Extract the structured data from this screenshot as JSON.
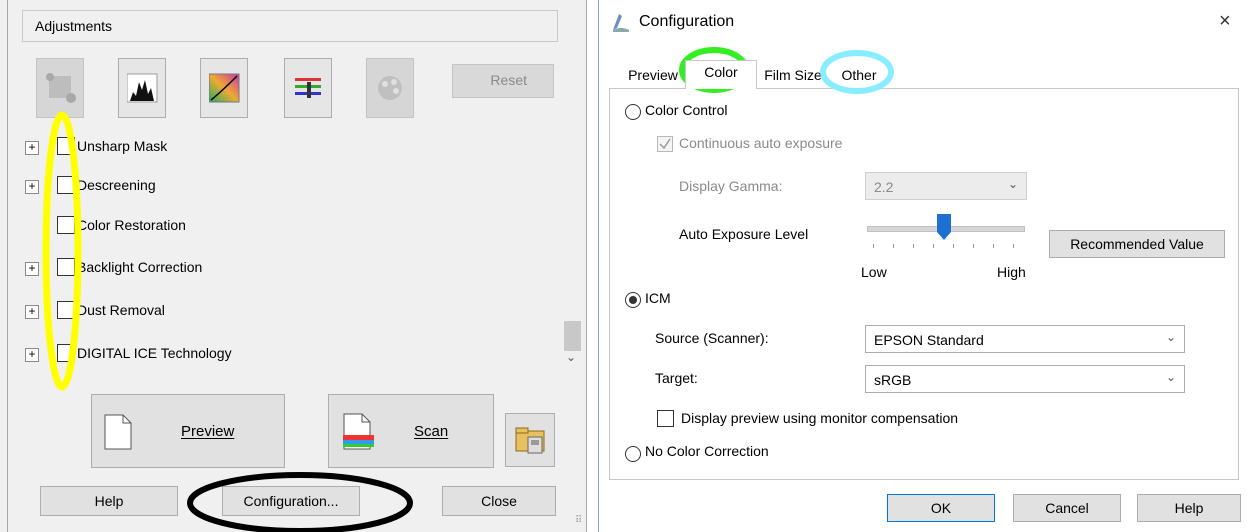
{
  "left_panel": {
    "adjustments_title": "Adjustments",
    "reset_label": "Reset",
    "adjustments": [
      {
        "label": "Unsharp Mask",
        "expandable": true
      },
      {
        "label": "Descreening",
        "expandable": true
      },
      {
        "label": "Color Restoration",
        "expandable": false
      },
      {
        "label": "Backlight Correction",
        "expandable": true
      },
      {
        "label": "Dust Removal",
        "expandable": true
      },
      {
        "label": "DIGITAL ICE Technology",
        "expandable": true
      }
    ],
    "expander_symbol": "+",
    "preview_label": "Preview",
    "scan_label": "Scan",
    "help_label": "Help",
    "configuration_label": "Configuration...",
    "close_label": "Close"
  },
  "dialog": {
    "title": "Configuration",
    "close_symbol": "×",
    "tabs": [
      "Preview",
      "Color",
      "Film Size",
      "Other"
    ],
    "active_tab": "Color",
    "color_control_label": "Color Control",
    "continuous_auto_exposure_label": "Continuous auto exposure",
    "display_gamma_label": "Display Gamma:",
    "display_gamma_value": "2.2",
    "auto_exposure_level_label": "Auto Exposure Level",
    "auto_exposure_low": "Low",
    "auto_exposure_high": "High",
    "recommended_value_label": "Recommended Value",
    "icm_label": "ICM",
    "source_label": "Source (Scanner):",
    "source_value": "EPSON Standard",
    "target_label": "Target:",
    "target_value": "sRGB",
    "display_preview_label": "Display preview using monitor compensation",
    "no_color_correction_label": "No Color Correction",
    "ok_label": "OK",
    "cancel_label": "Cancel",
    "help_label": "Help"
  },
  "colors": {
    "annotation_yellow": "#ffff00",
    "annotation_green": "#33ee22",
    "annotation_cyan": "#88eeff",
    "annotation_black": "#000000",
    "slider_thumb_blue": "#1e6fd0"
  }
}
